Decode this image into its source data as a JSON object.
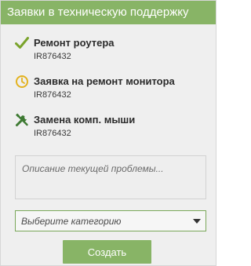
{
  "header": {
    "title": "Заявки в техническую поддержку"
  },
  "tickets": [
    {
      "title": "Ремонт роутера",
      "id": "IR876432",
      "status_icon": "checkmark-icon"
    },
    {
      "title": "Заявка на ремонт монитора",
      "id": "IR876432",
      "status_icon": "clock-icon"
    },
    {
      "title": "Замена комп. мыши",
      "id": "IR876432",
      "status_icon": "tools-icon"
    }
  ],
  "form": {
    "description_placeholder": "Описание текущей проблемы...",
    "category_selected": "Выберите категорию",
    "submit_label": "Создать"
  },
  "colors": {
    "accent": "#88b466",
    "check": "#7aa32b",
    "clock": "#e3b21f",
    "tools": "#3e7a33"
  }
}
